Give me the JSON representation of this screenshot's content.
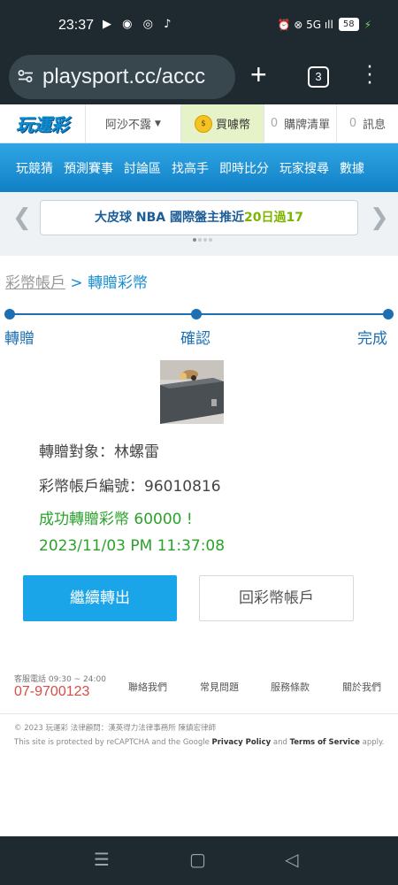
{
  "status_bar": {
    "time": "23:37",
    "left_icons": "▶ ◉ ◎ ♪",
    "right_icons": "⏰ ⊗ 5G ıll",
    "battery": "58",
    "charging_icon": "⚡"
  },
  "browser": {
    "url": "playsport.cc/accc",
    "tab_count": "3"
  },
  "site_header": {
    "logo": "玩運彩",
    "username": "阿沙不露",
    "buy_label": "買噱幣",
    "cart_count": "0",
    "cart_label": "購牌清單",
    "msg_count": "0",
    "msg_label": "訊息"
  },
  "nav": {
    "items": [
      "玩競猜",
      "預測賽事",
      "討論區",
      "找高手",
      "即時比分",
      "玩家搜尋",
      "數據"
    ]
  },
  "announcement": {
    "prefix": "大皮球",
    "league": "NBA",
    "middle": "國際盤主推近",
    "highlight": "20日過17"
  },
  "breadcrumb": {
    "parent": "彩幣帳戶",
    "separator": ">",
    "current": "轉贈彩幣"
  },
  "steps": [
    "轉贈",
    "確認",
    "完成"
  ],
  "result": {
    "recipient": "轉贈對象：林螺雷",
    "account": "彩幣帳戶編號：96010816",
    "success": "成功轉贈彩幣 60000 !",
    "datetime": "2023/11/03 PM 11:37:08"
  },
  "buttons": {
    "continue": "繼續轉出",
    "back": "回彩幣帳戶"
  },
  "footer": {
    "service_hours": "客服電話 09:30 ~ 24:00",
    "phone": "07-9700123",
    "links": [
      "聯絡我們",
      "常見問題",
      "服務條款",
      "關於我們"
    ],
    "copyright": "© 2023 玩運彩 法律顧問：漢英得力法律事務所 陳鎮宏律師",
    "captcha_prefix": "This site is protected by reCAPTCHA and the Google ",
    "privacy": "Privacy Policy",
    "and": " and ",
    "terms": "Terms of Service",
    "captcha_suffix": " apply."
  },
  "colors": {
    "accent_blue": "#1aa5e8",
    "step_blue": "#1d6fb3",
    "success_green": "#2aa32a",
    "phone_red": "#d84d44"
  }
}
